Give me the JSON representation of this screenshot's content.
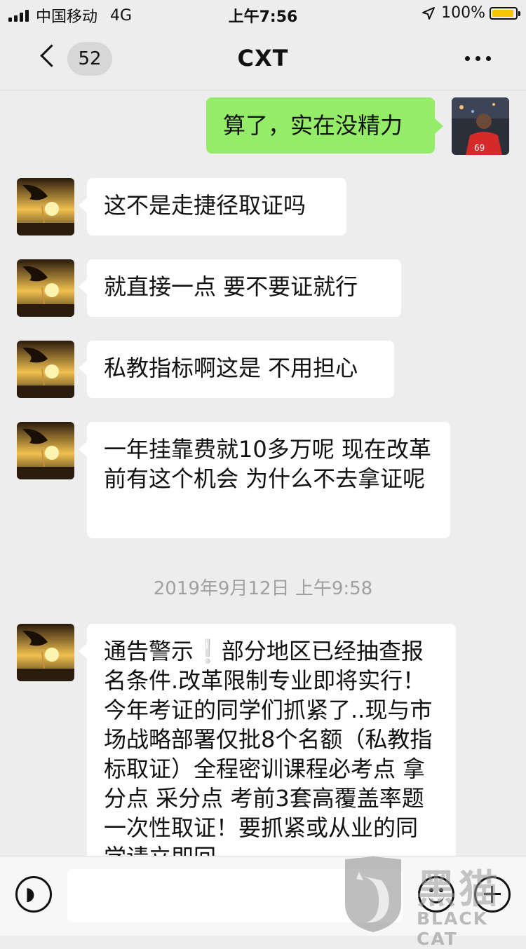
{
  "status_bar": {
    "carrier": "中国移动",
    "network": "4G",
    "time": "上午7:56",
    "battery": "100%",
    "location_icon": "location-arrow-icon",
    "battery_color": "#f7c600"
  },
  "nav": {
    "unread_count": "52",
    "title": "CXT",
    "back_icon": "chevron-left-icon",
    "more_icon": "more-dots-icon"
  },
  "messages": [
    {
      "from": "me",
      "text": "算了，实在没精力"
    },
    {
      "from": "other",
      "text": "这不是走捷径取证吗"
    },
    {
      "from": "other",
      "text": "就直接一点 要不要证就行"
    },
    {
      "from": "other",
      "text": "私教指标啊这是 不用担心"
    },
    {
      "from": "other",
      "text": "一年挂靠费就10多万呢 现在改革前有这个机会 为什么不去拿证呢"
    },
    {
      "from": "timestamp",
      "text": "2019年9月12日 上午9:58"
    },
    {
      "from": "other",
      "text": "通告警示❕部分地区已经抽查报名条件.改革限制专业即将实行！今年考证的同学们抓紧了..现与市场战略部署仅批8个名额（私教指标取证）全程密训课程必考点 拿分点 采分点 考前3套高覆盖率题 一次性取证！要抓紧或从业的同学请立即回"
    }
  ],
  "input_bar": {
    "voice_icon": "voice-icon",
    "emoji_icon": "emoji-icon",
    "plus_icon": "plus-icon",
    "value": ""
  },
  "watermark": {
    "text": "黑猫",
    "sub": "BLACK CAT"
  },
  "colors": {
    "background": "#ededed",
    "outgoing_bubble": "#95ec69",
    "incoming_bubble": "#ffffff"
  }
}
